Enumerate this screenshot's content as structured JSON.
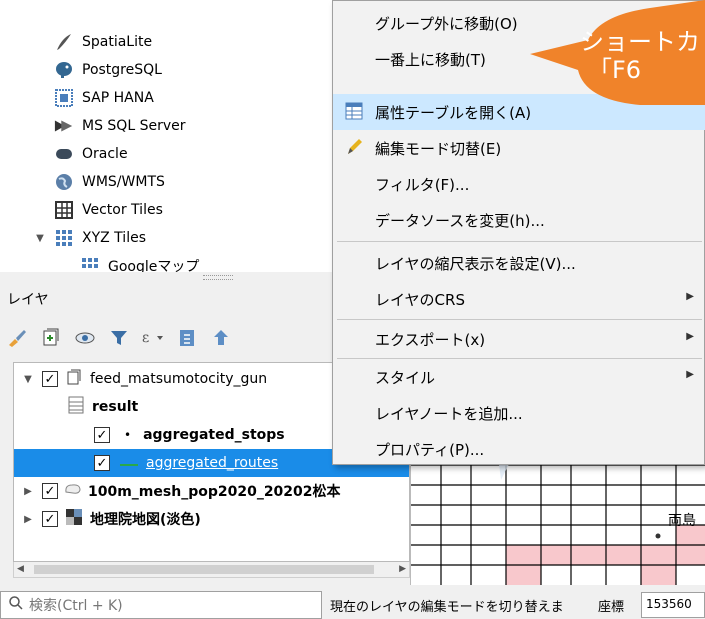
{
  "browser": {
    "items": [
      {
        "label": "SpatiaLite",
        "icon": "feather-icon"
      },
      {
        "label": "PostgreSQL",
        "icon": "elephant-icon"
      },
      {
        "label": "SAP HANA",
        "icon": "hana-icon"
      },
      {
        "label": "MS SQL Server",
        "icon": "mssql-icon"
      },
      {
        "label": "Oracle",
        "icon": "oracle-icon"
      },
      {
        "label": "WMS/WMTS",
        "icon": "globe-icon"
      },
      {
        "label": "Vector Tiles",
        "icon": "grid-icon"
      },
      {
        "label": "XYZ Tiles",
        "icon": "tiles-icon"
      },
      {
        "label": "Googleマップ",
        "icon": "tiles-icon"
      }
    ]
  },
  "layers": {
    "title": "レイヤ",
    "rows": [
      {
        "label": "feed_matsumotocity_gun",
        "checked": true
      },
      {
        "label": "result",
        "checked": null
      },
      {
        "label": "aggregated_stops",
        "checked": true
      },
      {
        "label": "aggregated_routes",
        "checked": true,
        "selected": true
      },
      {
        "label": "100m_mesh_pop2020_20202松本",
        "checked": true
      },
      {
        "label": "地理院地図(淡色)",
        "checked": true
      }
    ]
  },
  "context_menu": {
    "items": [
      {
        "label": "グループ外に移動(O)"
      },
      {
        "label": "一番上に移動(T)"
      },
      {
        "label": "属性テーブルを開く(A)",
        "highlighted": true
      },
      {
        "label": "編集モード切替(E)"
      },
      {
        "label": "フィルタ(F)..."
      },
      {
        "label": "データソースを変更(h)..."
      },
      {
        "label": "レイヤの縮尺表示を設定(V)..."
      },
      {
        "label": "レイヤのCRS",
        "submenu": true
      },
      {
        "label": "エクスポート(x)",
        "submenu": true
      },
      {
        "label": "スタイル",
        "submenu": true
      },
      {
        "label": "レイヤノートを追加..."
      },
      {
        "label": "プロパティ(P)..."
      }
    ]
  },
  "callout": {
    "line1": "ショートカ",
    "line2": "「F6"
  },
  "status": {
    "search_placeholder": "検索(Ctrl + K)",
    "message": "現在のレイヤの編集モードを切り替えま",
    "coord_label": "座標",
    "coord_value": "153560"
  },
  "map": {
    "place_label": "両島"
  },
  "colors": {
    "selection": "#1a8ce8",
    "menu_highlight": "#cce8ff",
    "callout": "#f0832a",
    "mesh_pink": "#f8c8cc"
  }
}
